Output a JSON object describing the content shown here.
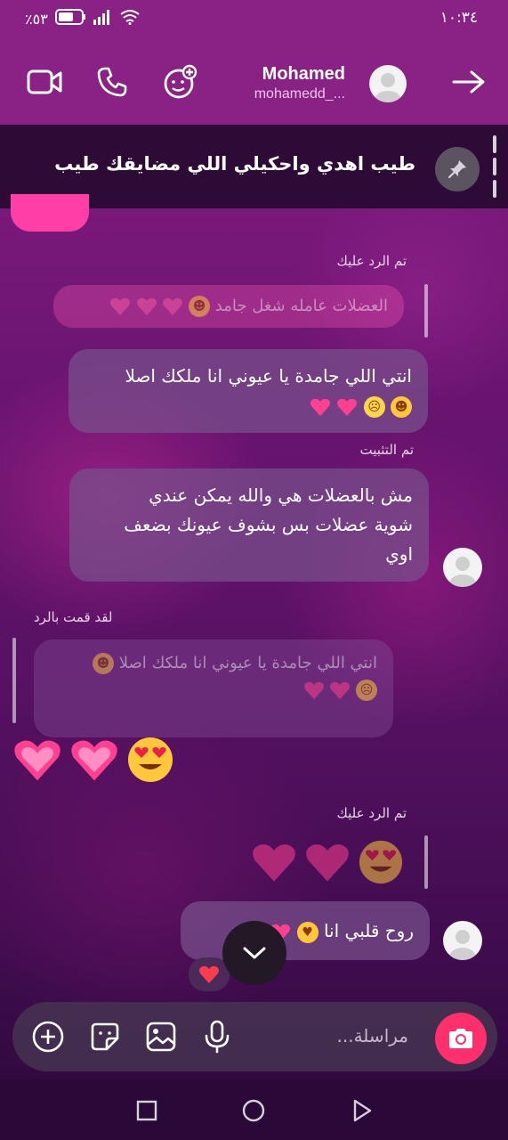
{
  "status_bar": {
    "battery": "٪٥٣",
    "time": "١٠:٣٤"
  },
  "header": {
    "name": "Mohamed",
    "username": "mohamedd_..."
  },
  "pinned": {
    "text": "طيب اهدي واحكيلي اللي مضايقك طيب"
  },
  "messages": {
    "label_replied_1": "تم الرد عليك",
    "quote_1": "العضلات عامله شغل جامد",
    "bubble_1_line1": "انتي اللي جامدة يا عيوني انا ملكك اصلا",
    "label_pinned": "تم التثبيت",
    "bubble_2_line1": "مش بالعضلات هي والله يمكن عندي",
    "bubble_2_line2": "شوية عضلات بس بشوف عيونك بضعف",
    "bubble_2_line3": "اوي",
    "label_i_replied": "لقد قمت بالرد",
    "quote_2_line1": "انتي اللي جامدة يا عيوني انا ملكك اصلا",
    "label_replied_2": "تم الرد عليك",
    "bubble_3": "روح قلبي انا"
  },
  "composer": {
    "placeholder": "مراسلة..."
  },
  "colors": {
    "header": "#8a2285",
    "accent_pink": "#ff3fa7",
    "camera": "#ff2f6d"
  }
}
